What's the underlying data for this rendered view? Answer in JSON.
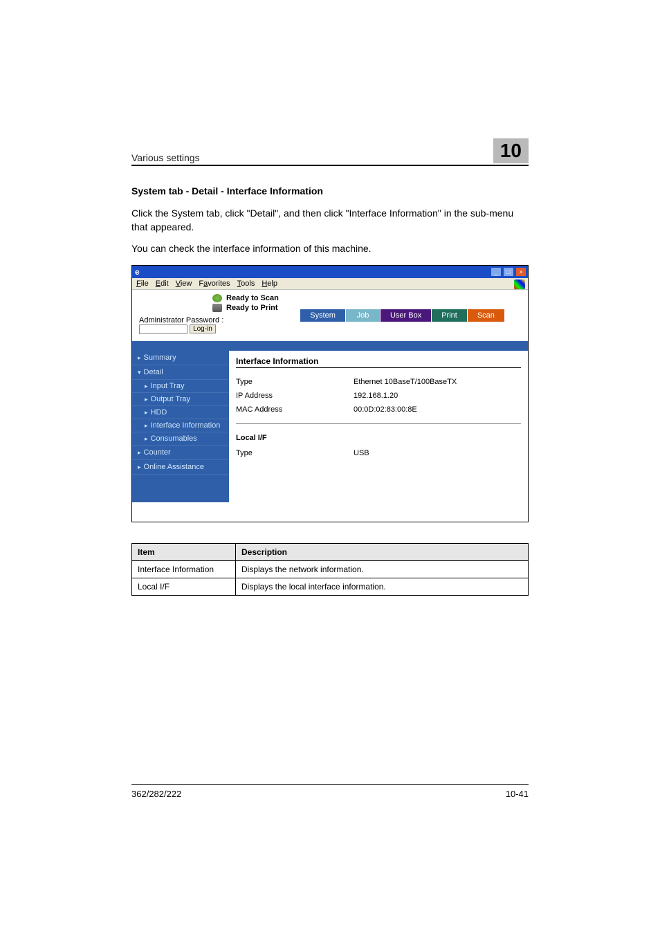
{
  "header": {
    "left": "Various settings",
    "chapter": "10"
  },
  "section_title": "System tab - Detail - Interface Information",
  "para1": "Click the System tab, click \"Detail\", and then click \"Interface Information\" in the sub-menu that appeared.",
  "para2": "You can check the interface information of this machine.",
  "browser": {
    "ie_e": "e",
    "menu": {
      "file": "File",
      "edit": "Edit",
      "view": "View",
      "favorites": "Favorites",
      "tools": "Tools",
      "help": "Help"
    },
    "status": {
      "scan": "Ready to Scan",
      "print": "Ready to Print"
    },
    "admin": {
      "label": "Administrator Password :",
      "login": "Log-in"
    },
    "tabs": {
      "system": "System",
      "job": "Job",
      "userbox": "User Box",
      "print": "Print",
      "scan": "Scan"
    },
    "sidebar": {
      "summary": "Summary",
      "detail": "Detail",
      "input_tray": "Input Tray",
      "output_tray": "Output Tray",
      "hdd": "HDD",
      "interface": "Interface Information",
      "consumables": "Consumables",
      "counter": "Counter",
      "online": "Online Assistance"
    },
    "main": {
      "title": "Interface Information",
      "type_label": "Type",
      "type_val": "Ethernet 10BaseT/100BaseTX",
      "ip_label": "IP Address",
      "ip_val": "192.168.1.20",
      "mac_label": "MAC Address",
      "mac_val": "00:0D:02:83:00:8E",
      "local_title": "Local I/F",
      "local_type_label": "Type",
      "local_type_val": "USB"
    }
  },
  "table": {
    "h_item": "Item",
    "h_desc": "Description",
    "rows": [
      {
        "item": "Interface Information",
        "desc": "Displays the network information."
      },
      {
        "item": "Local I/F",
        "desc": "Displays the local interface information."
      }
    ]
  },
  "footer": {
    "left": "362/282/222",
    "right": "10-41"
  }
}
